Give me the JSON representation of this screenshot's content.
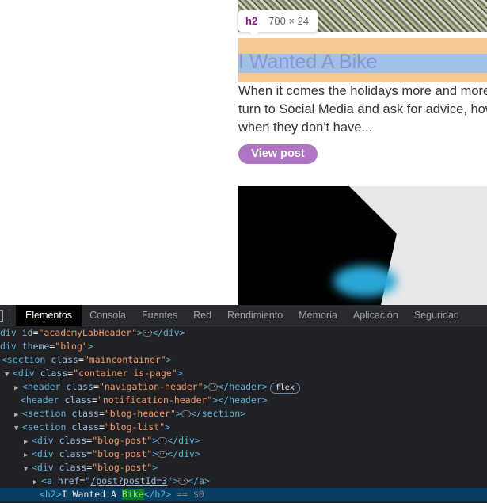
{
  "page": {
    "tooltip": {
      "tag": "h2",
      "dims": "700 × 24"
    },
    "post_title": "I Wanted A Bike",
    "excerpt": [
      "When it comes the holidays more and more p",
      "turn to Social Media and ask for advice, how",
      "when they don't have..."
    ],
    "view_post": "View post"
  },
  "devtools": {
    "tabs": [
      "Elementos",
      "Consola",
      "Fuentes",
      "Red",
      "Rendimiento",
      "Memoria",
      "Aplicación",
      "Seguridad"
    ],
    "dom": {
      "r1": {
        "pre": "div ",
        "attr": "id",
        "val": "\"academyLabHeader\"",
        "close": "</div>"
      },
      "r2": {
        "pre": "div ",
        "attr": "theme",
        "val": "\"blog\""
      },
      "r3": {
        "pre": "<section ",
        "attr": "class",
        "val": "\"maincontainer\""
      },
      "r4": {
        "pre": "<div ",
        "attr": "class",
        "val": "\"container is-page\""
      },
      "r5": {
        "pre": "<header ",
        "attr": "class",
        "val": "\"navigation-header\"",
        "close": "</header>",
        "badge": "flex"
      },
      "r6": {
        "pre": "<header ",
        "attr": "class",
        "val": "\"notification-header\"",
        "close": "</header>"
      },
      "r7": {
        "pre": "<section ",
        "attr": "class",
        "val": "\"blog-header\"",
        "close": "</section>"
      },
      "r8": {
        "pre": "<section ",
        "attr": "class",
        "val": "\"blog-list\""
      },
      "r9": {
        "pre": "<div ",
        "attr": "class",
        "val": "\"blog-post\"",
        "close": "</div>"
      },
      "r10": {
        "pre": "<div ",
        "attr": "class",
        "val": "\"blog-post\"",
        "close": "</div>"
      },
      "r11": {
        "pre": "<div ",
        "attr": "class",
        "val": "\"blog-post\""
      },
      "r12": {
        "pre": "<a ",
        "attr": "href",
        "val": "/post?postId=3",
        "close": "</a>"
      },
      "r13": {
        "open": "<h2>",
        "text": "I Wanted A ",
        "hl": "Bike",
        "close": "</h2>",
        "eq": "== $0"
      }
    }
  }
}
